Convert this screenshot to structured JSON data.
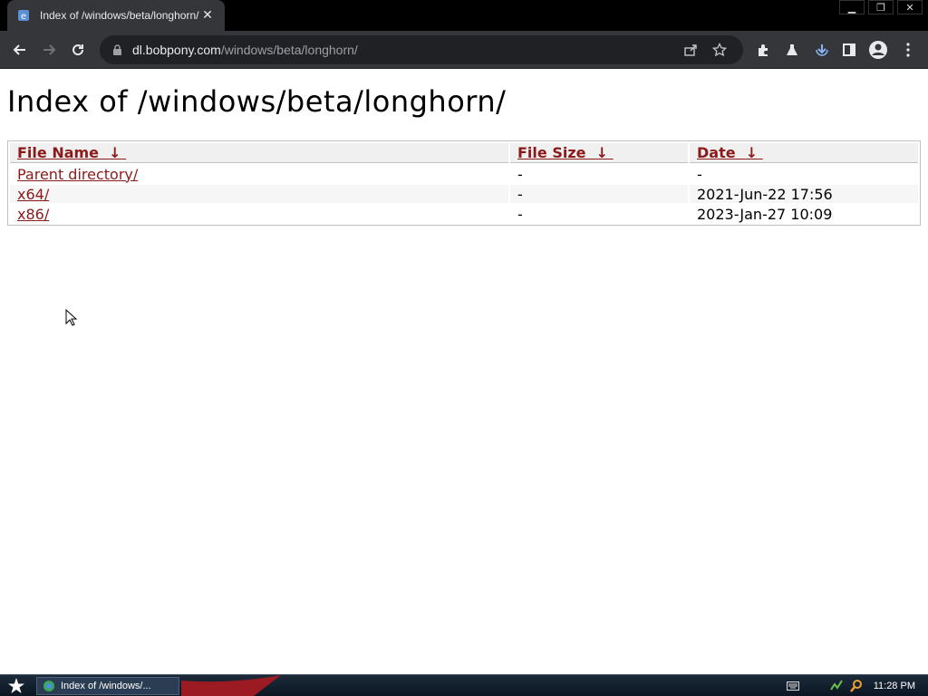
{
  "browser": {
    "tab_title": "Index of /windows/beta/longhorn/",
    "close_glyph": "✕",
    "window_controls": [
      "▁",
      "❐",
      "✕"
    ],
    "url_host": "dl.bobpony.com",
    "url_path": "/windows/beta/longhorn/"
  },
  "page": {
    "heading": "Index of /windows/beta/longhorn/",
    "columns": [
      {
        "label": "File Name",
        "sort": "↓"
      },
      {
        "label": "File Size",
        "sort": "↓"
      },
      {
        "label": "Date",
        "sort": "↓"
      }
    ],
    "rows": [
      {
        "name": "Parent directory/",
        "size": "-",
        "date": "-"
      },
      {
        "name": "x64/",
        "size": "-",
        "date": "2021-Jun-22 17:56"
      },
      {
        "name": "x86/",
        "size": "-",
        "date": "2023-Jan-27 10:09"
      }
    ]
  },
  "taskbar": {
    "task_label": "Index of /windows/...",
    "clock": "11:28 PM"
  },
  "colors": {
    "link": "#8b1a1a",
    "chrome_dark": "#35363a",
    "omnibox": "#202124"
  }
}
